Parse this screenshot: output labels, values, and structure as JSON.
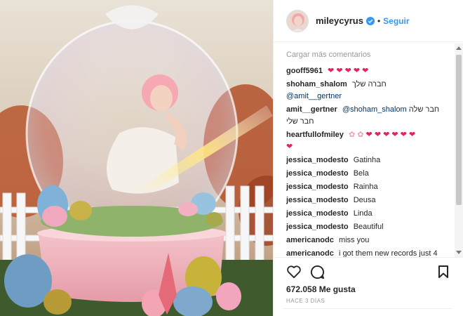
{
  "post": {
    "username": "mileycyrus",
    "follow_label": "Seguir",
    "separator": "•",
    "load_more": "Cargar más comentarios",
    "likes": "672.058 Me gusta",
    "time_ago": "HACE 3 DÍAS"
  },
  "comments": [
    {
      "user": "gooff5961",
      "text": "",
      "icons": [
        "heart",
        "heart",
        "heart",
        "heart",
        "heart"
      ]
    },
    {
      "user": "shoham_shalom",
      "text": "חברה שלך",
      "mention": "@amit__gertner"
    },
    {
      "user": "amit__gertner",
      "mention": "@shoham_shalom",
      "text": "חבר שלה חבר שלי"
    },
    {
      "user": "heartfullofmiley",
      "text": "",
      "icons": [
        "blossom",
        "blossom",
        "heart",
        "heart",
        "heart",
        "heart",
        "heart",
        "heart",
        "heart"
      ]
    },
    {
      "user": "jessica_modesto",
      "text": "Gatinha"
    },
    {
      "user": "jessica_modesto",
      "text": "Bela"
    },
    {
      "user": "jessica_modesto",
      "text": "Rainha"
    },
    {
      "user": "jessica_modesto",
      "text": "Deusa"
    },
    {
      "user": "jessica_modesto",
      "text": "Linda"
    },
    {
      "user": "jessica_modesto",
      "text": "Beautiful"
    },
    {
      "user": "americanodc",
      "text": "miss you"
    },
    {
      "user": "americanodc",
      "text": "i got them new records just 4"
    }
  ],
  "icons": {
    "like": "heart-outline-icon",
    "comment": "speech-bubble-icon",
    "save": "bookmark-icon",
    "verified": "verified-badge-icon"
  },
  "colors": {
    "link": "#3897f0",
    "heart": "#e0245e",
    "blossom": "#f29bbd",
    "muted": "#999999"
  }
}
